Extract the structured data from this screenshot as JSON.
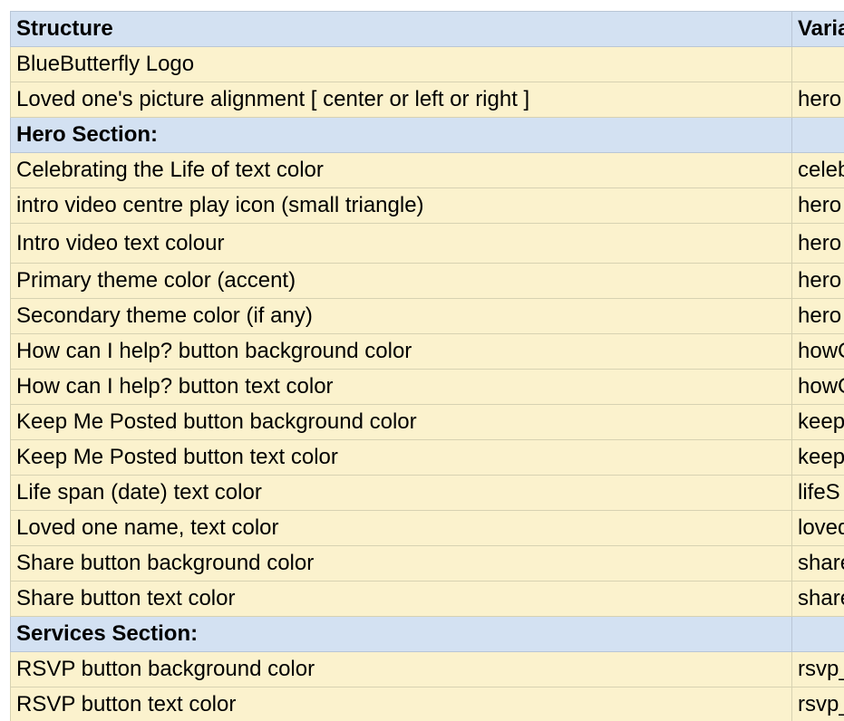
{
  "table": {
    "headers": {
      "structure": "Structure",
      "variable": "Varia"
    },
    "rows": [
      {
        "type": "data",
        "structure": "BlueButterfly Logo",
        "variable": ""
      },
      {
        "type": "data",
        "structure": "Loved one's picture alignment [ center or left or right ]",
        "variable": "hero"
      },
      {
        "type": "section",
        "structure": "Hero Section:",
        "variable": ""
      },
      {
        "type": "data",
        "structure": "Celebrating the Life of text color",
        "variable": "celeb"
      },
      {
        "type": "data",
        "structure": "intro video centre play icon (small triangle)",
        "variable": "hero"
      },
      {
        "type": "data",
        "structure": "Intro video text colour",
        "variable": "hero"
      },
      {
        "type": "data",
        "structure": "Primary theme color (accent)",
        "variable": "hero"
      },
      {
        "type": "data",
        "structure": "Secondary theme color (if any)",
        "variable": "hero"
      },
      {
        "type": "data",
        "structure": "How can I help? button background color",
        "variable": "howC"
      },
      {
        "type": "data",
        "structure": "How can I help? button text color",
        "variable": "howC"
      },
      {
        "type": "data",
        "structure": "Keep Me Posted button background color",
        "variable": "keep"
      },
      {
        "type": "data",
        "structure": "Keep Me Posted button text color",
        "variable": "keep"
      },
      {
        "type": "data",
        "structure": "Life span (date) text color",
        "variable": "lifeS"
      },
      {
        "type": "data",
        "structure": "Loved one name, text color",
        "variable": "loved"
      },
      {
        "type": "data",
        "structure": "Share button background color",
        "variable": "share"
      },
      {
        "type": "data",
        "structure": "Share button text color",
        "variable": "share"
      },
      {
        "type": "section",
        "structure": "Services Section:",
        "variable": ""
      },
      {
        "type": "data",
        "structure": "RSVP button background color",
        "variable": "rsvp_"
      },
      {
        "type": "data",
        "structure": "RSVP button text color",
        "variable": "rsvp_"
      }
    ]
  }
}
